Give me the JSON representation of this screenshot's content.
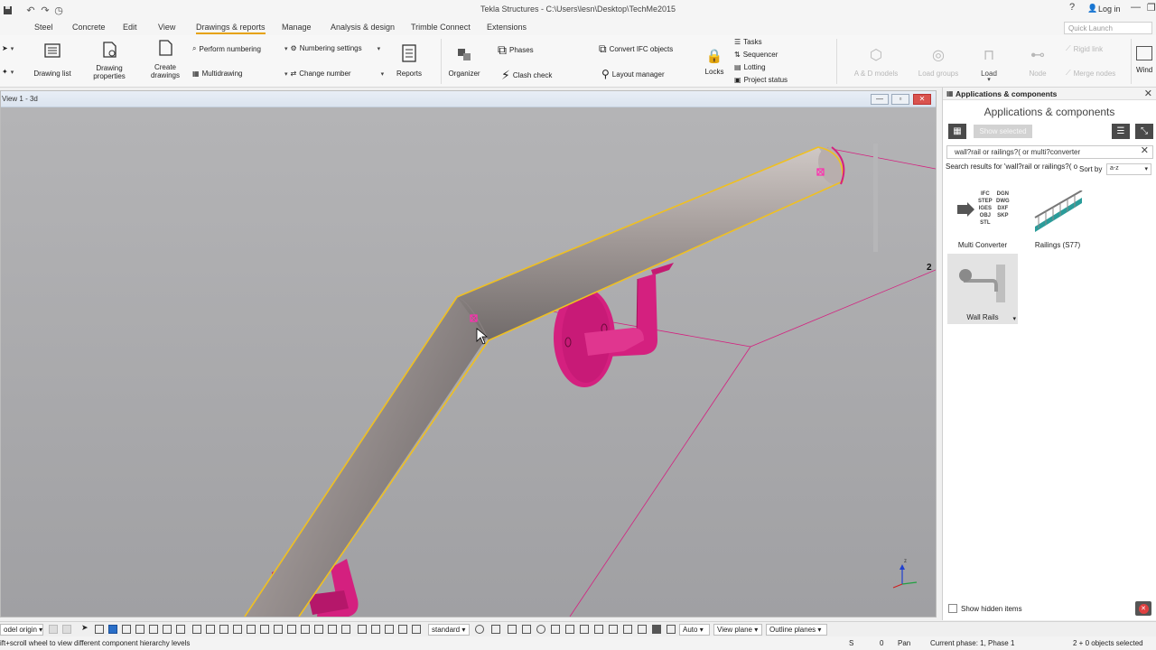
{
  "app": {
    "title": "Tekla Structures - C:\\Users\\lesn\\Desktop\\TechMe2015",
    "login": "Log in",
    "quick_launch_placeholder": "Quick Launch"
  },
  "menu_tabs": [
    "Steel",
    "Concrete",
    "Edit",
    "View",
    "Drawings & reports",
    "Manage",
    "Analysis & design",
    "Trimble Connect",
    "Extensions"
  ],
  "active_tab": "Drawings & reports",
  "ribbon": {
    "drawing_list": "Drawing list",
    "drawing_properties_1": "Drawing",
    "drawing_properties_2": "properties",
    "create_drawings_1": "Create",
    "create_drawings_2": "drawings",
    "perform_numbering": "Perform numbering",
    "multidrawing": "Multidrawing",
    "numbering_settings": "Numbering settings",
    "change_number": "Change number",
    "reports": "Reports",
    "organizer": "Organizer",
    "phases": "Phases",
    "clash_check": "Clash check",
    "convert_ifc": "Convert IFC objects",
    "layout_manager": "Layout manager",
    "locks": "Locks",
    "tasks": "Tasks",
    "sequencer": "Sequencer",
    "lotting": "Lotting",
    "project_status": "Project status",
    "ad_models": "A & D models",
    "load_groups": "Load groups",
    "load": "Load",
    "node": "Node",
    "rigid_link": "Rigid link",
    "merge_nodes": "Merge nodes",
    "windows": "Wind"
  },
  "viewport": {
    "title": "View 1 - 3d",
    "grid_label": "2"
  },
  "panel": {
    "header": "Applications & components",
    "title": "Applications & components",
    "show_selected": "Show selected",
    "search_value": "wall?rail or railings?( or multi?converter",
    "results_label": "Search results for 'wall?rail or railings?( or multi?converter'",
    "sort_by": "Sort by",
    "sort_value": "a-z",
    "items": [
      {
        "label": "Multi Converter",
        "icon_text": [
          "IFC",
          "STEP",
          "IGES",
          "OBJ",
          "STL",
          "DGN",
          "DWG",
          "DXF",
          "SKP"
        ]
      },
      {
        "label": "Railings (S77)"
      },
      {
        "label": "Wall Rails"
      }
    ],
    "show_hidden": "Show hidden items"
  },
  "bottom_toolbar": {
    "model_origin": "odel origin",
    "standard": "standard",
    "auto": "Auto",
    "view_plane": "View plane",
    "outline_planes": "Outline planes"
  },
  "status": {
    "hint": "ift+scroll wheel to view different component hierarchy levels",
    "s": "S",
    "zero": "0",
    "pan": "Pan",
    "phase": "Current phase: 1, Phase 1",
    "selected": "2 + 0 objects selected"
  },
  "colors": {
    "accent": "#e6a20a",
    "magenta": "#d4207f",
    "background": "#a6a6a8"
  }
}
